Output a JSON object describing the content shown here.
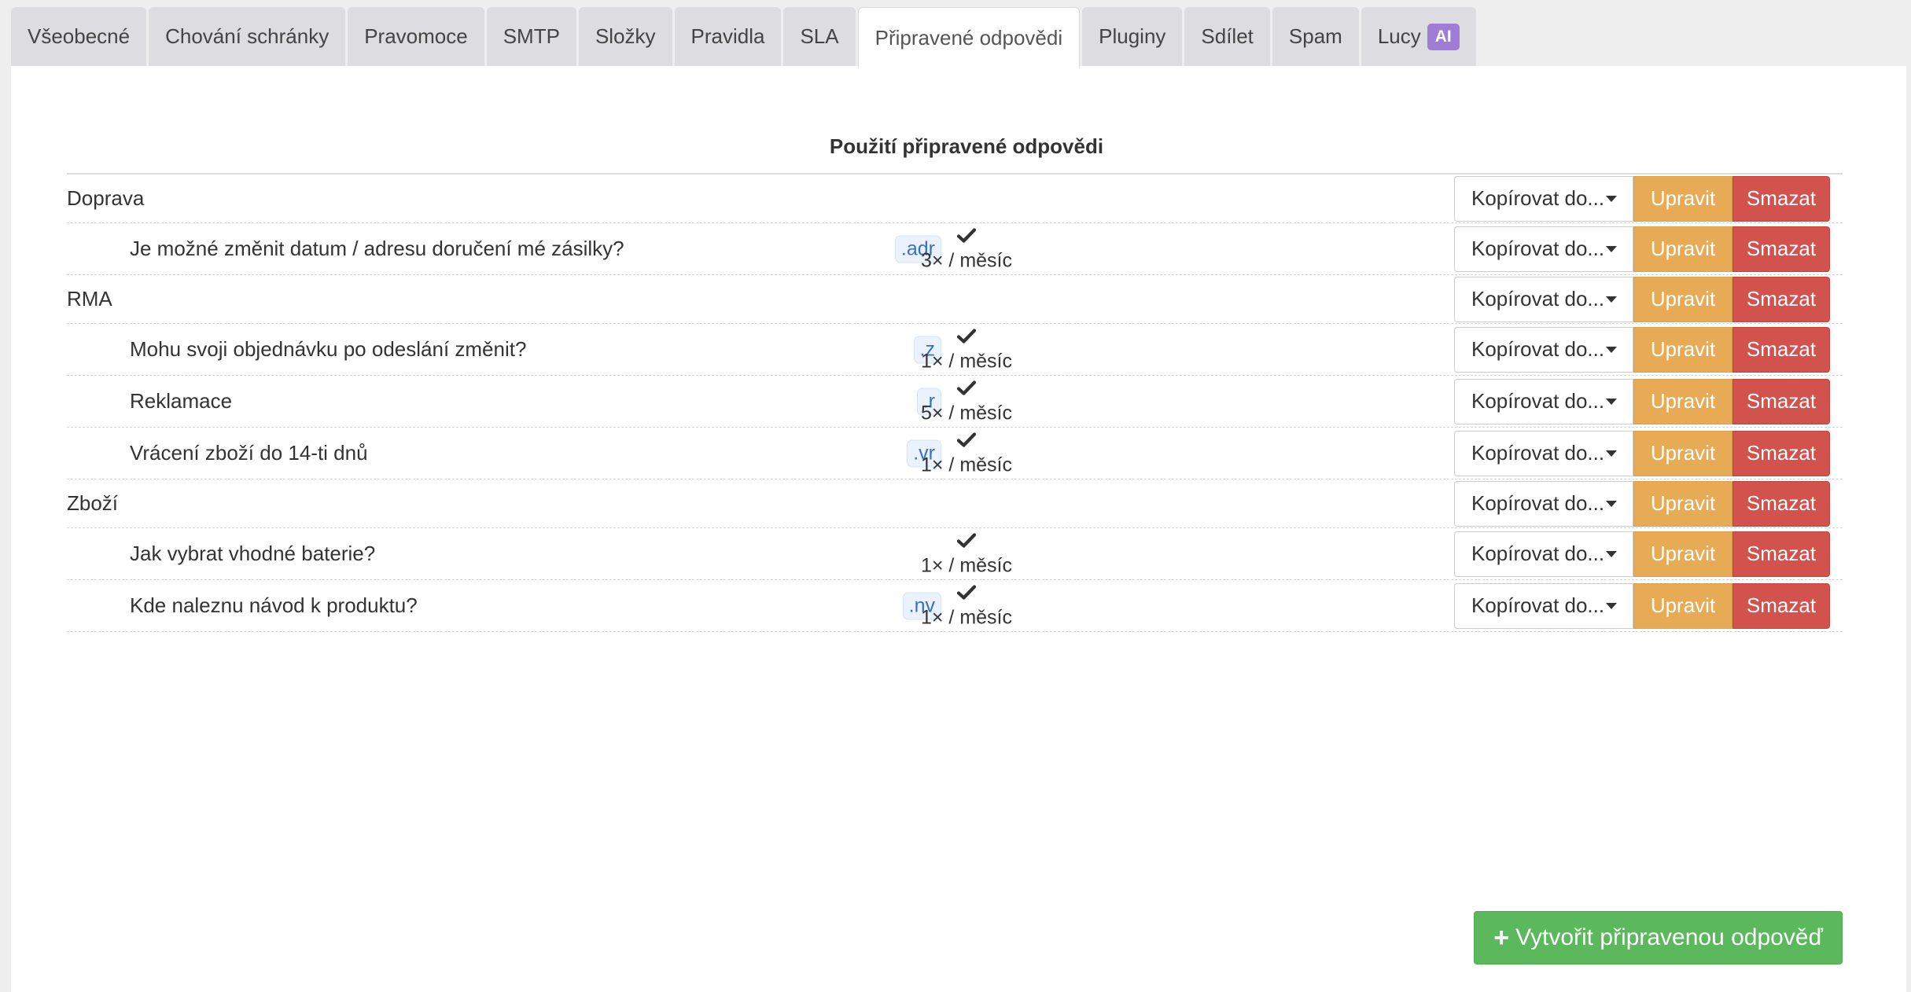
{
  "tabs": [
    {
      "label": "Všeobecné"
    },
    {
      "label": "Chování schránky"
    },
    {
      "label": "Pravomoce"
    },
    {
      "label": "SMTP"
    },
    {
      "label": "Složky"
    },
    {
      "label": "Pravidla"
    },
    {
      "label": "SLA"
    },
    {
      "label": "Připravené odpovědi",
      "active": true
    },
    {
      "label": "Pluginy"
    },
    {
      "label": "Sdílet"
    },
    {
      "label": "Spam"
    },
    {
      "label": "Lucy",
      "badge": "AI"
    }
  ],
  "table": {
    "usage_header": "Použití připravené odpovědi",
    "copy_label": "Kopírovat do...",
    "edit_label": "Upravit",
    "delete_label": "Smazat",
    "rows": [
      {
        "type": "category",
        "title": "Doprava"
      },
      {
        "type": "item",
        "title": "Je možné změnit datum / adresu doručení mé zásilky?",
        "shortcut": ".adr",
        "used": true,
        "usage": "3× / měsíc"
      },
      {
        "type": "category",
        "title": "RMA"
      },
      {
        "type": "item",
        "title": "Mohu svoji objednávku po odeslání změnit?",
        "shortcut": ".z",
        "used": true,
        "usage": "1× / měsíc"
      },
      {
        "type": "item",
        "title": "Reklamace",
        "shortcut": ".r",
        "used": true,
        "usage": "5× / měsíc"
      },
      {
        "type": "item",
        "title": "Vrácení zboží do 14-ti dnů",
        "shortcut": ".vr",
        "used": true,
        "usage": "1× / měsíc"
      },
      {
        "type": "category",
        "title": "Zboží"
      },
      {
        "type": "item",
        "title": "Jak vybrat vhodné baterie?",
        "shortcut": "",
        "used": true,
        "usage": "1× / měsíc"
      },
      {
        "type": "item",
        "title": "Kde naleznu návod k produktu?",
        "shortcut": ".nv",
        "used": true,
        "usage": "1× / měsíc"
      }
    ]
  },
  "create_button_label": "Vytvořit připravenou odpověď",
  "colors": {
    "edit": "#e8ab55",
    "delete": "#d2524e",
    "create": "#5cb85c",
    "ai_badge": "#a07cd6",
    "shortcut_text": "#3a6fc4"
  }
}
